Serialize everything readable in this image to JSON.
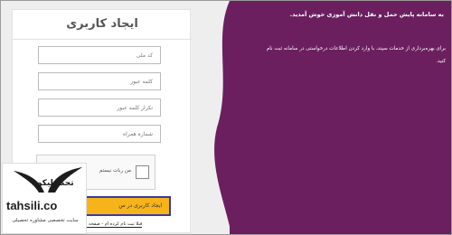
{
  "signup_form": {
    "title": "ایجاد کاربری",
    "fields": {
      "national_code_placeholder": "کد ملی",
      "password_placeholder": "کلمه عبور",
      "password_repeat_placeholder": "تکرار کلمه عبور",
      "mobile_placeholder": "شماره همراه"
    },
    "captcha": {
      "label": "من ربات نیستم"
    },
    "submit_label": "ایجاد کاربری در س",
    "login_link": "قبلا ثبت نام کرده ام - صفحه ورود"
  },
  "info_panel": {
    "welcome": "به سامانه پایش حمل و نقل دانش آموزی خوش آمدید.",
    "description": "برای بهره‌برداری از خدمات سپند، با وارد کردن اطلاعات درخواستی در سامانه ثبت نام کنید."
  },
  "watermark": {
    "brand": "تحصیلیکو",
    "domain": "tahsili.co",
    "tagline": "سایت تخصصی مشاوره تحصیلی"
  },
  "colors": {
    "panel_purple": "#6b1f5f",
    "submit_yellow": "#f6b31a",
    "submit_border": "#3a3aa0"
  }
}
